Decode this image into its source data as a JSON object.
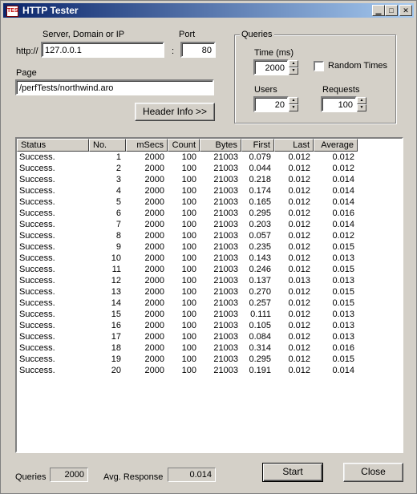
{
  "window": {
    "title": "HTTP Tester",
    "icon": "app-icon"
  },
  "server": {
    "label": "Server, Domain or IP",
    "prefix": "http://",
    "value": "127.0.0.1",
    "separator": ":",
    "port_label": "Port",
    "port_value": "80"
  },
  "page": {
    "label": "Page",
    "value": "/perfTests/northwind.aro"
  },
  "header_button": "Header Info >>",
  "queries": {
    "group_label": "Queries",
    "time_label": "Time  (ms)",
    "time_value": "2000",
    "random_label": "Random Times",
    "random_checked": false,
    "users_label": "Users",
    "users_value": "20",
    "requests_label": "Requests",
    "requests_value": "100"
  },
  "table": {
    "columns": [
      "Status",
      "No.",
      "mSecs",
      "Count",
      "Bytes",
      "First",
      "Last",
      "Average"
    ],
    "rows": [
      [
        "Success.",
        "1",
        "2000",
        "100",
        "21003",
        "0.079",
        "0.012",
        "0.012"
      ],
      [
        "Success.",
        "2",
        "2000",
        "100",
        "21003",
        "0.044",
        "0.012",
        "0.012"
      ],
      [
        "Success.",
        "3",
        "2000",
        "100",
        "21003",
        "0.218",
        "0.012",
        "0.014"
      ],
      [
        "Success.",
        "4",
        "2000",
        "100",
        "21003",
        "0.174",
        "0.012",
        "0.014"
      ],
      [
        "Success.",
        "5",
        "2000",
        "100",
        "21003",
        "0.165",
        "0.012",
        "0.014"
      ],
      [
        "Success.",
        "6",
        "2000",
        "100",
        "21003",
        "0.295",
        "0.012",
        "0.016"
      ],
      [
        "Success.",
        "7",
        "2000",
        "100",
        "21003",
        "0.203",
        "0.012",
        "0.014"
      ],
      [
        "Success.",
        "8",
        "2000",
        "100",
        "21003",
        "0.057",
        "0.012",
        "0.012"
      ],
      [
        "Success.",
        "9",
        "2000",
        "100",
        "21003",
        "0.235",
        "0.012",
        "0.015"
      ],
      [
        "Success.",
        "10",
        "2000",
        "100",
        "21003",
        "0.143",
        "0.012",
        "0.013"
      ],
      [
        "Success.",
        "11",
        "2000",
        "100",
        "21003",
        "0.246",
        "0.012",
        "0.015"
      ],
      [
        "Success.",
        "12",
        "2000",
        "100",
        "21003",
        "0.137",
        "0.013",
        "0.013"
      ],
      [
        "Success.",
        "13",
        "2000",
        "100",
        "21003",
        "0.270",
        "0.012",
        "0.015"
      ],
      [
        "Success.",
        "14",
        "2000",
        "100",
        "21003",
        "0.257",
        "0.012",
        "0.015"
      ],
      [
        "Success.",
        "15",
        "2000",
        "100",
        "21003",
        "0.111",
        "0.012",
        "0.013"
      ],
      [
        "Success.",
        "16",
        "2000",
        "100",
        "21003",
        "0.105",
        "0.012",
        "0.013"
      ],
      [
        "Success.",
        "17",
        "2000",
        "100",
        "21003",
        "0.084",
        "0.012",
        "0.013"
      ],
      [
        "Success.",
        "18",
        "2000",
        "100",
        "21003",
        "0.314",
        "0.012",
        "0.016"
      ],
      [
        "Success.",
        "19",
        "2000",
        "100",
        "21003",
        "0.295",
        "0.012",
        "0.015"
      ],
      [
        "Success.",
        "20",
        "2000",
        "100",
        "21003",
        "0.191",
        "0.012",
        "0.014"
      ]
    ]
  },
  "footer": {
    "queries_label": "Queries",
    "queries_value": "2000",
    "avg_label": "Avg. Response",
    "avg_value": "0.014",
    "start_button": "Start",
    "close_button": "Close"
  },
  "colors": {
    "title_start": "#0a246a",
    "title_end": "#a6caf0",
    "face": "#d4d0c8"
  }
}
